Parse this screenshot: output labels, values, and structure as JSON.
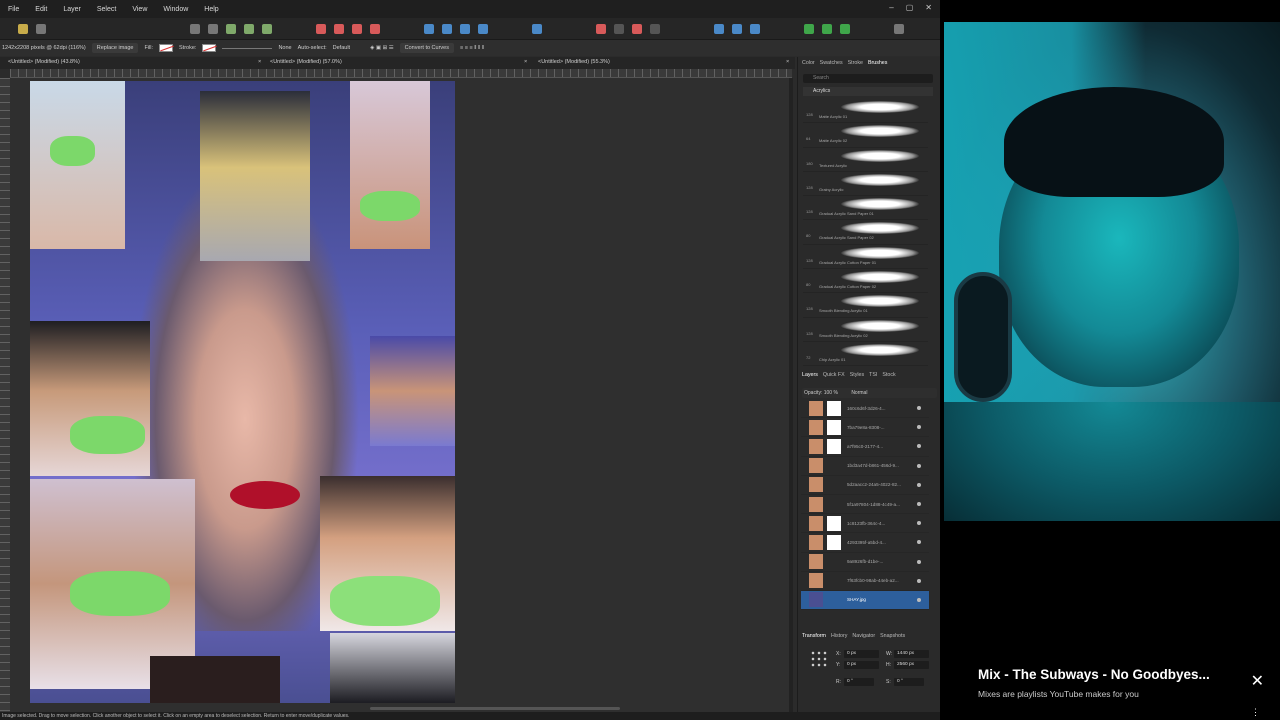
{
  "menu": [
    "File",
    "Edit",
    "Layer",
    "Select",
    "View",
    "Window",
    "Help"
  ],
  "context_bar": {
    "image_info": "1242x2208 pixels @ 62dpi (116%)",
    "replace_image": "Replace image",
    "fill_label": "Fill:",
    "stroke_label": "Stroke:",
    "stroke_value": "None",
    "autoselect_label": "Auto-select:",
    "autoselect_value": "Default",
    "convert_to_curves": "Convert to Curves"
  },
  "doc_tabs": [
    {
      "label": "<Untitled> (Modified) (43.8%)"
    },
    {
      "label": "<Untitled> (Modified) (57.0%)"
    },
    {
      "label": "<Untitled> (Modified) (55.3%)"
    }
  ],
  "panels": {
    "top_tabs": [
      "Color",
      "Swatches",
      "Stroke",
      "Brushes"
    ],
    "active_top_tab": "Brushes",
    "search_placeholder": "Search",
    "brush_category": "Acrylics",
    "brushes": [
      {
        "size": "128",
        "name": "Matte Acrylic 01"
      },
      {
        "size": "64",
        "name": "Matte Acrylic 02"
      },
      {
        "size": "180",
        "name": "Textured Acrylic"
      },
      {
        "size": "128",
        "name": "Grainy Acrylic"
      },
      {
        "size": "128",
        "name": "Gradual Acrylic Sand Paper 01"
      },
      {
        "size": "80",
        "name": "Gradual Acrylic Sand Paper 02"
      },
      {
        "size": "128",
        "name": "Gradual Acrylic Cotton Paper 01"
      },
      {
        "size": "80",
        "name": "Gradual Acrylic Cotton Paper 02"
      },
      {
        "size": "128",
        "name": "Smooth Blending Acrylic 01"
      },
      {
        "size": "128",
        "name": "Smooth Blending Acrylic 02"
      },
      {
        "size": "72",
        "name": "Chip Acrylic 01"
      }
    ],
    "layer_tabs": [
      "Layers",
      "Quick FX",
      "Styles",
      "TSI",
      "Stock"
    ],
    "opacity_label": "Opacity:",
    "opacity_value": "100 %",
    "blend_mode": "Normal",
    "layers": [
      {
        "name": "160c6d6f-3d26-4...",
        "selected": false,
        "mask": true
      },
      {
        "name": "7ba79e8a-8308-...",
        "selected": false,
        "mask": true
      },
      {
        "name": "a7f95c0-2177-4...",
        "selected": false,
        "mask": true
      },
      {
        "name": "1bd3a47d-b861-456d-9...",
        "selected": false,
        "mask": false
      },
      {
        "name": "5d2aacc2-24a5-4022-82...",
        "selected": false,
        "mask": false
      },
      {
        "name": "5f1a97804-1d88-4c49-a...",
        "selected": false,
        "mask": false
      },
      {
        "name": "1c8123fb-364c-4...",
        "selected": false,
        "mask": true
      },
      {
        "name": "4293395f-a5bd-4...",
        "selected": false,
        "mask": true
      },
      {
        "name": "9a8926fb-d1be-...",
        "selected": false,
        "mask": false
      },
      {
        "name": "7f63fcb0-98ab-44eb-a2...",
        "selected": false,
        "mask": false
      },
      {
        "name": "SHAY.jpg",
        "selected": true,
        "mask": false
      }
    ],
    "bottom_tabs": [
      "Transform",
      "History",
      "Navigator",
      "Snapshots"
    ],
    "transform": {
      "x": "0 px",
      "y": "0 px",
      "w": "1440 px",
      "h": "2560 px",
      "r": "0 °",
      "s": "0 °"
    }
  },
  "status_text": "Image selected. Drag to move selection. Click another object to select it. Click on an empty area to deselect selection. Return to enter move/duplicate values.",
  "youtube": {
    "title": "Mix - The Subways - No Goodbyes...",
    "subtitle": "Mixes are playlists YouTube makes for you"
  }
}
